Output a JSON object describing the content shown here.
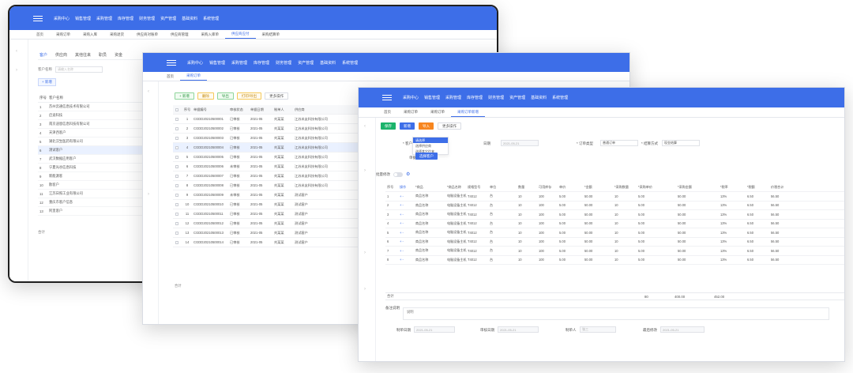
{
  "colors": {
    "brand_blue": "#3d6ee8",
    "primary_green": "#1bb36b",
    "warning_orange": "#f7861f"
  },
  "win1": {
    "nav": [
      "采购中心",
      "销售管理",
      "采购管理",
      "库存管理",
      "财务管理",
      "资产管理",
      "基础资料",
      "系统管理"
    ],
    "tabs": [
      "首页",
      "采购订单",
      "采购入库",
      "采购退货",
      "供应商对账单",
      "供应商管理",
      "采购入库单",
      "供应商应付",
      "采购结算单"
    ],
    "subtabs": [
      "客户",
      "供应商",
      "其他往来",
      "职员",
      "资金"
    ],
    "filter_label": "客户名称",
    "filter_placeholder": "请输入名称",
    "add_label": "+ 新增",
    "list_header": {
      "no": "序号",
      "name": "客户名称"
    },
    "rows": [
      {
        "no": "1",
        "name": "苏州云通信息技术有限公司"
      },
      {
        "no": "2",
        "name": "启迪科技"
      },
      {
        "no": "3",
        "name": "南京迪恩信息科技有限公司"
      },
      {
        "no": "4",
        "name": "天津西客户"
      },
      {
        "no": "5",
        "name": "湖北汉生医药有限公司"
      },
      {
        "no": "6",
        "name": "测试客户"
      },
      {
        "no": "7",
        "name": "武汉数据应用客户"
      },
      {
        "no": "8",
        "name": "宁夏光谷信息科技"
      },
      {
        "no": "9",
        "name": "新能源客"
      },
      {
        "no": "10",
        "name": "散客户"
      },
      {
        "no": "11",
        "name": "江苏日照工业有限公司"
      },
      {
        "no": "12",
        "name": "重庆市客户信息"
      },
      {
        "no": "13",
        "name": "阿里客户"
      }
    ],
    "total_label": "合计"
  },
  "win2": {
    "nav": [
      "采购中心",
      "销售管理",
      "采购管理",
      "库存管理",
      "财务管理",
      "资产管理",
      "基础资料",
      "系统管理"
    ],
    "tabs": [
      "首页",
      "采购订单"
    ],
    "toolbar": {
      "add": "+ 新增",
      "delete": "删除",
      "import": "导出",
      "print": "打印/导出",
      "more": "更多操作"
    },
    "header": {
      "no": "序号",
      "code": "单据编号",
      "status": "审核状态",
      "date": "单据日期",
      "type": "制单人",
      "vendor": "供应商"
    },
    "rows": [
      {
        "no": "1",
        "code": "CGDD20210500001",
        "status": "已审核",
        "date": "2021-05",
        "type": "刘某某",
        "vendor": "江苏米友科技有限公司"
      },
      {
        "no": "2",
        "code": "CGDD20210500002",
        "status": "已审核",
        "date": "2021-05",
        "type": "刘某某",
        "vendor": "江苏米友科技有限公司"
      },
      {
        "no": "3",
        "code": "CGDD20210500003",
        "status": "已审核",
        "date": "2021-05",
        "type": "刘某某",
        "vendor": "江苏米友科技有限公司"
      },
      {
        "no": "4",
        "code": "CGDD20210500004",
        "status": "已审核",
        "date": "2021-05",
        "type": "刘某某",
        "vendor": "江苏米友科技有限公司"
      },
      {
        "no": "5",
        "code": "CGDD20210500005",
        "status": "已审核",
        "date": "2021-05",
        "type": "刘某某",
        "vendor": "江苏米友科技有限公司"
      },
      {
        "no": "6",
        "code": "CGDD20210500006",
        "status": "未审核",
        "date": "2021-05",
        "type": "刘某某",
        "vendor": "江苏米友科技有限公司"
      },
      {
        "no": "7",
        "code": "CGDD20210500007",
        "status": "已审核",
        "date": "2021-05",
        "type": "刘某某",
        "vendor": "江苏米友科技有限公司"
      },
      {
        "no": "8",
        "code": "CGDD20210500008",
        "status": "已审核",
        "date": "2021-05",
        "type": "刘某某",
        "vendor": "江苏米友科技有限公司"
      },
      {
        "no": "9",
        "code": "CGDD20210500009",
        "status": "未审核",
        "date": "2021-05",
        "type": "刘某某",
        "vendor": "测试客户"
      },
      {
        "no": "10",
        "code": "CGDD20210500010",
        "status": "已审核",
        "date": "2021-05",
        "type": "刘某某",
        "vendor": "测试客户"
      },
      {
        "no": "11",
        "code": "CGDD20210500011",
        "status": "已审核",
        "date": "2021-05",
        "type": "刘某某",
        "vendor": "测试客户"
      },
      {
        "no": "12",
        "code": "CGDD20210500012",
        "status": "已审核",
        "date": "2021-05",
        "type": "刘某某",
        "vendor": "测试客户"
      },
      {
        "no": "13",
        "code": "CGDD20210500013",
        "status": "已审核",
        "date": "2021-05",
        "type": "刘某某",
        "vendor": "测试客户"
      },
      {
        "no": "14",
        "code": "CGDD20210500014",
        "status": "已审核",
        "date": "2021-05",
        "type": "刘某某",
        "vendor": "测试客户"
      }
    ],
    "total_label": "合计"
  },
  "win3": {
    "nav": [
      "采购中心",
      "销售管理",
      "采购管理",
      "库存管理",
      "财务管理",
      "资产管理",
      "基础资料",
      "系统管理"
    ],
    "tabs": [
      "首页",
      "采购订单",
      "采购订单",
      "采购订单新增"
    ],
    "toolbar": {
      "save": "保存",
      "save_new": "新增",
      "audit": "导入",
      "more": "更多操作"
    },
    "form": {
      "customer_label": "* 客户",
      "customer_value": "请选择",
      "date_label": "日期",
      "date_value": "2021-05-21",
      "order_type_label": "* 订单类型",
      "order_type_value": "普通订单",
      "settle_label": "* 结算方式",
      "settle_value": "现金结算",
      "bill_label": "单据编号",
      "search_btn": "选择客户"
    },
    "dropdown": [
      "请选择",
      "选择供应商",
      "选择其它往来"
    ],
    "toggle_label": "批量修改",
    "header": [
      "序号",
      "操作",
      "*商品",
      "*商品名称",
      "规格型号",
      "单位",
      "数量",
      "可用库存",
      "单价",
      "*金额",
      "*采购数量",
      "*采购单价",
      "*采购金额",
      "*税率",
      "*税额",
      "价税合计"
    ],
    "rows": [
      [
        "1",
        "+ -",
        "商品名称",
        "电脑设备主机",
        "T4012",
        "台",
        "10",
        "100",
        "5.00",
        "50.00",
        "10",
        "5.00",
        "50.00",
        "13%",
        "6.50",
        "56.50"
      ],
      [
        "2",
        "+ -",
        "商品名称",
        "电脑设备主机",
        "T4012",
        "台",
        "10",
        "100",
        "5.00",
        "50.00",
        "10",
        "5.00",
        "50.00",
        "13%",
        "6.50",
        "56.50"
      ],
      [
        "3",
        "+ -",
        "商品名称",
        "电脑设备主机",
        "T4012",
        "台",
        "10",
        "100",
        "5.00",
        "50.00",
        "10",
        "5.00",
        "50.00",
        "13%",
        "6.50",
        "56.50"
      ],
      [
        "4",
        "+ -",
        "商品名称",
        "电脑设备主机",
        "T4012",
        "台",
        "10",
        "100",
        "5.00",
        "50.00",
        "10",
        "5.00",
        "50.00",
        "13%",
        "6.50",
        "56.50"
      ],
      [
        "5",
        "+ -",
        "商品名称",
        "电脑设备主机",
        "T4012",
        "台",
        "10",
        "100",
        "5.00",
        "50.00",
        "10",
        "5.00",
        "50.00",
        "13%",
        "6.50",
        "56.50"
      ],
      [
        "6",
        "+ -",
        "商品名称",
        "电脑设备主机",
        "T4012",
        "台",
        "10",
        "100",
        "5.00",
        "50.00",
        "10",
        "5.00",
        "50.00",
        "13%",
        "6.50",
        "56.50"
      ],
      [
        "7",
        "+ -",
        "商品名称",
        "电脑设备主机",
        "T4012",
        "台",
        "10",
        "100",
        "5.00",
        "50.00",
        "10",
        "5.00",
        "50.00",
        "13%",
        "6.50",
        "56.50"
      ],
      [
        "8",
        "+ -",
        "商品名称",
        "电脑设备主机",
        "T4012",
        "台",
        "10",
        "100",
        "5.00",
        "50.00",
        "10",
        "5.00",
        "50.00",
        "13%",
        "6.50",
        "56.50"
      ]
    ],
    "total": {
      "label": "合计",
      "qty": "80",
      "amount": "400.00",
      "tax_total": "452.00"
    },
    "footer": {
      "remark_label": "备注说明",
      "remark_value": "说明",
      "maker_label": "制单日期",
      "maker_value": "2021-05-21",
      "checker_label": "审核日期",
      "checker_value": "2021-05-21",
      "handler_label": "制单人",
      "handler_value": "张三",
      "print_label": "最后修改",
      "print_value": "2021-05-21"
    }
  }
}
